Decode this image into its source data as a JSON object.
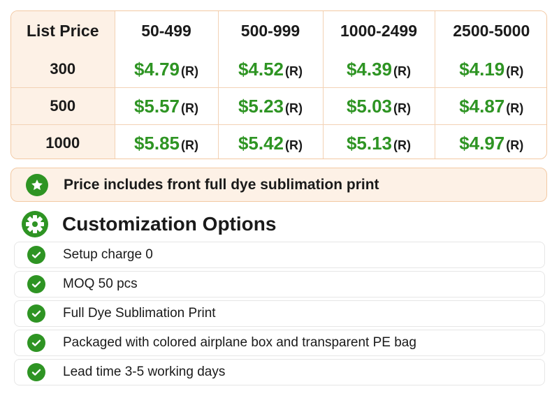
{
  "price_table": {
    "corner_label": "List Price",
    "columns": [
      "50-499",
      "500-999",
      "1000-2499",
      "2500-5000"
    ],
    "rows": [
      {
        "quantity": "300",
        "prices": [
          "$4.79",
          "$4.52",
          "$4.39",
          "$4.19"
        ]
      },
      {
        "quantity": "500",
        "prices": [
          "$5.57",
          "$5.23",
          "$5.03",
          "$4.87"
        ]
      },
      {
        "quantity": "1000",
        "prices": [
          "$5.85",
          "$5.42",
          "$5.13",
          "$4.97"
        ]
      }
    ],
    "price_suffix": "(R)"
  },
  "note": {
    "icon": "star-icon",
    "text": "Price includes front full dye sublimation print"
  },
  "customization": {
    "icon": "gear-icon",
    "title": "Customization Options",
    "items": [
      "Setup charge 0",
      "MOQ 50 pcs",
      "Full Dye Sublimation Print",
      "Packaged with colored airplane box and transparent PE bag",
      "Lead time 3-5 working days"
    ]
  },
  "colors": {
    "accent_green": "#2e9423",
    "border_peach": "#f3c9a3",
    "fill_peach": "#fdf1e6"
  }
}
